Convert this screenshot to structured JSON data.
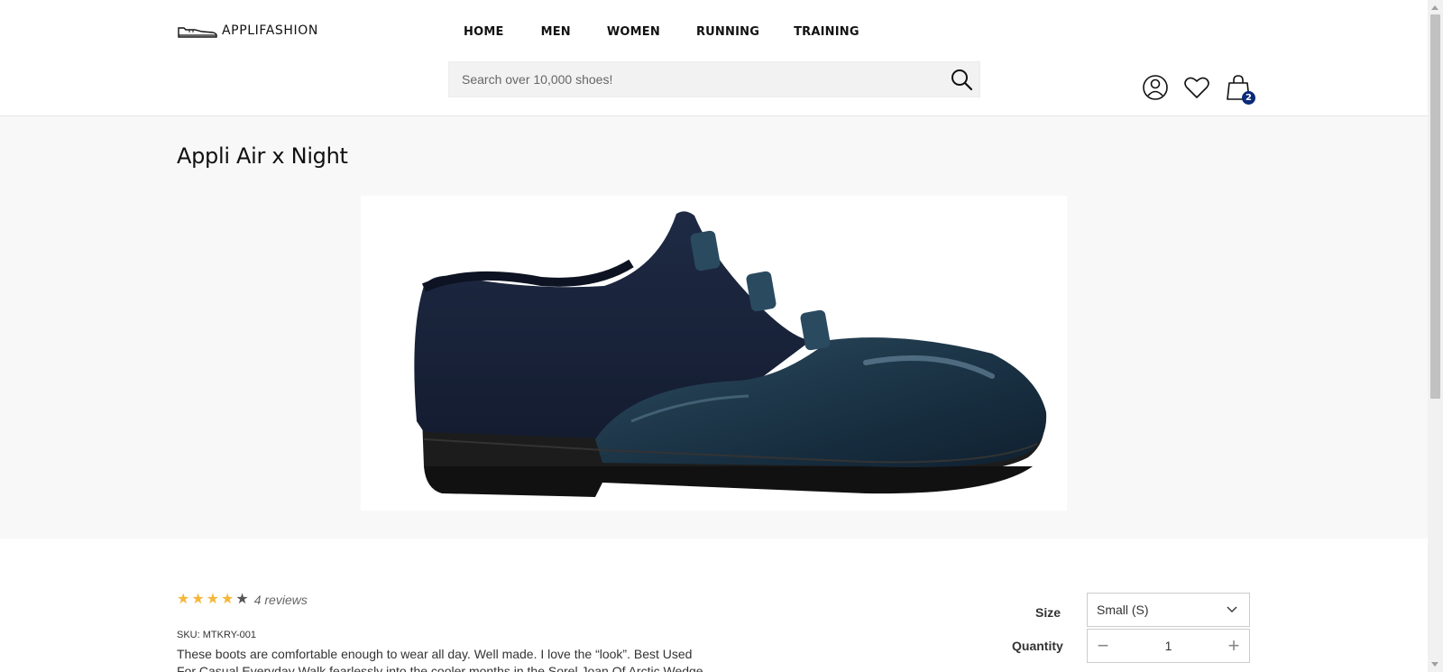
{
  "header": {
    "logo_text": "APPLIFASHION",
    "nav": [
      {
        "label": "HOME"
      },
      {
        "label": "MEN"
      },
      {
        "label": "WOMEN"
      },
      {
        "label": "RUNNING"
      },
      {
        "label": "TRAINING"
      }
    ],
    "search": {
      "placeholder": "Search over 10,000 shoes!",
      "icon": "search-icon"
    },
    "icons": [
      "user-icon",
      "heart-icon",
      "bag-icon"
    ],
    "cart_count": "2",
    "badge_color": "#0a2a7a"
  },
  "product": {
    "title": "Appli Air x Night",
    "image_icon": "shoe-image",
    "rating": {
      "value": 4,
      "max": 5,
      "reviews_label": "4 reviews",
      "star_color": "#f5b63a"
    },
    "sku": "SKU: MTKRY-001",
    "description": "These boots are comfortable enough to wear all day. Well made. I love the “look”. Best Used For Casual Everyday Walk fearlessly into the cooler months in the Sorel Joan Of Arctic Wedge",
    "size": {
      "label": "Size",
      "selected": "Small (S)"
    },
    "quantity": {
      "label": "Quantity",
      "value": "1",
      "minus": "−",
      "plus": "+"
    }
  }
}
